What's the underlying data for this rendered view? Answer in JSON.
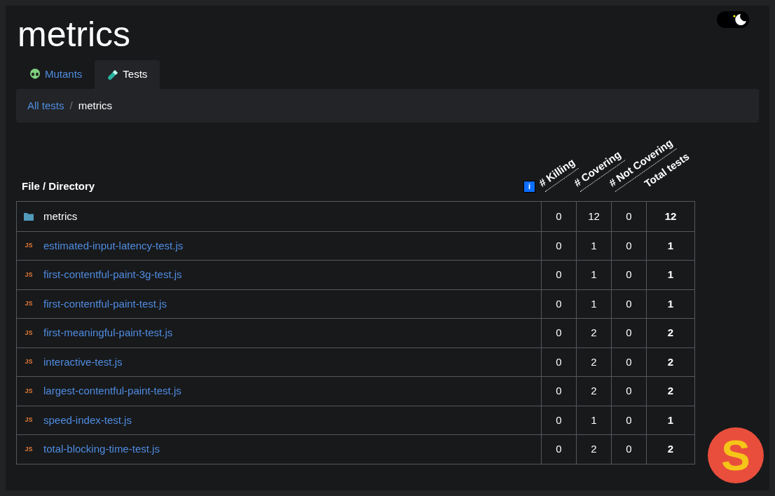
{
  "title": "metrics",
  "theme_toggle": {
    "on": true
  },
  "tabs": [
    {
      "label": "Mutants",
      "kind": "mutants",
      "selected": false
    },
    {
      "label": "Tests",
      "kind": "tests",
      "selected": true
    }
  ],
  "breadcrumb": {
    "separator": "/",
    "items": [
      {
        "label": "All tests",
        "link": true
      },
      {
        "label": "metrics",
        "link": false
      }
    ]
  },
  "info_badge": "i",
  "table": {
    "columns": [
      "File / Directory",
      "# Killing",
      "# Covering",
      "# Not Covering",
      "Total tests"
    ],
    "rows": [
      {
        "kind": "directory",
        "cells": [
          "metrics",
          "0",
          "12",
          "0",
          "12"
        ]
      },
      {
        "kind": "file",
        "badge": "JS",
        "cells": [
          "estimated-input-latency-test.js",
          "0",
          "1",
          "0",
          "1"
        ]
      },
      {
        "kind": "file",
        "badge": "JS",
        "cells": [
          "first-contentful-paint-3g-test.js",
          "0",
          "1",
          "0",
          "1"
        ]
      },
      {
        "kind": "file",
        "badge": "JS",
        "cells": [
          "first-contentful-paint-test.js",
          "0",
          "1",
          "0",
          "1"
        ]
      },
      {
        "kind": "file",
        "badge": "JS",
        "cells": [
          "first-meaningful-paint-test.js",
          "0",
          "2",
          "0",
          "2"
        ]
      },
      {
        "kind": "file",
        "badge": "JS",
        "cells": [
          "interactive-test.js",
          "0",
          "2",
          "0",
          "2"
        ]
      },
      {
        "kind": "file",
        "badge": "JS",
        "cells": [
          "largest-contentful-paint-test.js",
          "0",
          "2",
          "0",
          "2"
        ]
      },
      {
        "kind": "file",
        "badge": "JS",
        "cells": [
          "speed-index-test.js",
          "0",
          "1",
          "0",
          "1"
        ]
      },
      {
        "kind": "file",
        "badge": "JS",
        "cells": [
          "total-blocking-time-test.js",
          "0",
          "2",
          "0",
          "2"
        ]
      }
    ]
  },
  "logo": {
    "letter": "S"
  }
}
